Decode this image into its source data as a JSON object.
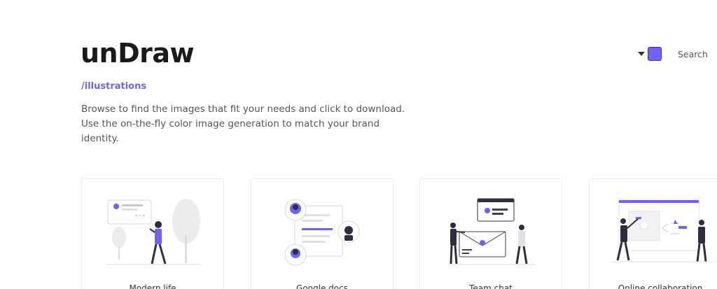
{
  "header": {
    "logo": "unDraw",
    "subtitle": "/illustrations",
    "description": "Browse to find the images that fit your needs and click to download. Use the on-the-fly color image generation to match your brand identity.",
    "search_label": "Search",
    "accent_color": "#6c63ff"
  },
  "cards": [
    {
      "label": "Modern life",
      "icon": "modern-life-illustration"
    },
    {
      "label": "Google docs",
      "icon": "google-docs-illustration"
    },
    {
      "label": "Team chat",
      "icon": "team-chat-illustration"
    },
    {
      "label": "Online collaboration",
      "icon": "online-collaboration-illustration"
    }
  ]
}
